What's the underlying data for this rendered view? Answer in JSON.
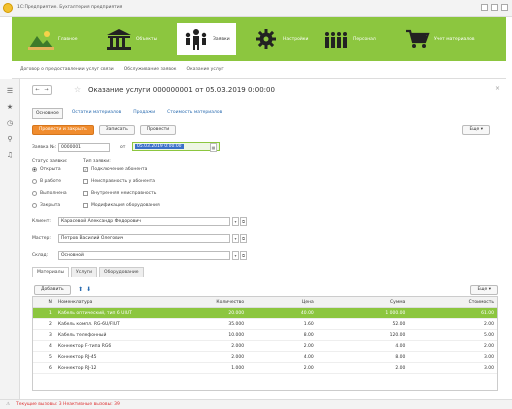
{
  "window": {
    "title": "1С:Предприятие. Бухгалтерия предприятия"
  },
  "ribbon": {
    "items": [
      {
        "label": "Главное",
        "icon": "landscape-icon",
        "active": false
      },
      {
        "label": "Объекты",
        "icon": "building-icon",
        "active": false
      },
      {
        "label": "Заявки",
        "icon": "people-icon",
        "active": true
      },
      {
        "label": "Настройки",
        "icon": "gear-icon",
        "active": false
      },
      {
        "label": "Персонал",
        "icon": "team-icon",
        "active": false
      },
      {
        "label": "Учет материалов",
        "icon": "cart-icon",
        "active": false
      }
    ]
  },
  "breadcrumbs": [
    "Договор о предоставлении услуг связи",
    "Обслуживание заявок",
    "Оказание услуг"
  ],
  "form": {
    "title": "Оказание услуги 000000001 от 05.03.2019 0:00:00",
    "links": [
      "Основное",
      "Остатки материалов",
      "Продажи",
      "Стоимость материалов"
    ],
    "toolbar": {
      "post_close": "Провести и закрыть",
      "write": "Записать",
      "post": "Провести",
      "more": "Еще"
    },
    "number_label": "Заявка №:",
    "number_value": "0000001",
    "date_label": "от",
    "date_value": "05.03.2019 0:00:00",
    "status_label": "Статус заявки:",
    "type_label": "Тип заявки:",
    "statuses": [
      {
        "label": "Открыта",
        "checked": true
      },
      {
        "label": "В работе",
        "checked": false
      },
      {
        "label": "Выполнена",
        "checked": false
      },
      {
        "label": "Закрыта",
        "checked": false
      }
    ],
    "types": [
      {
        "label": "Подключение абонента",
        "checked": true
      },
      {
        "label": "Неисправность у абонента",
        "checked": false
      },
      {
        "label": "Внутренняя неисправность",
        "checked": false
      },
      {
        "label": "Модификация оборудования",
        "checked": false
      }
    ],
    "client_label": "Клиент:",
    "client_value": "Карасевой Александр Федорович",
    "master_label": "Мастер:",
    "master_value": "Петров Василий Олегович",
    "warehouse_label": "Склад:",
    "warehouse_value": "Основной"
  },
  "tabs": [
    "Материалы",
    "Услуги",
    "Оборудование"
  ],
  "table": {
    "add_label": "Добавить",
    "more_label": "Еще",
    "columns": [
      "N",
      "Номенклатура",
      "Количество",
      "Цена",
      "Сумма",
      "Стоимость"
    ],
    "rows": [
      [
        "1",
        "Кабель оптический, тип 6 UIUT",
        "20.000",
        "40.00",
        "1 000.00",
        "61.00"
      ],
      [
        "2",
        "Кабель компл. RG-6U/FIUT",
        "35.000",
        "1.60",
        "52.00",
        "2.00"
      ],
      [
        "3",
        "Кабель телефонный",
        "10.000",
        "8.00",
        "120.00",
        "5.00"
      ],
      [
        "4",
        "Коннектор F-типа RG6",
        "2.000",
        "2.00",
        "4.00",
        "2.00"
      ],
      [
        "5",
        "Коннектор RJ-45",
        "2.000",
        "4.00",
        "8.00",
        "3.00"
      ],
      [
        "6",
        "Коннектор RJ-12",
        "1.000",
        "2.00",
        "2.00",
        "3.00"
      ]
    ]
  },
  "status_bar": {
    "text": "Текущие вызовы: 3 Неактивные вызовы: 39"
  }
}
